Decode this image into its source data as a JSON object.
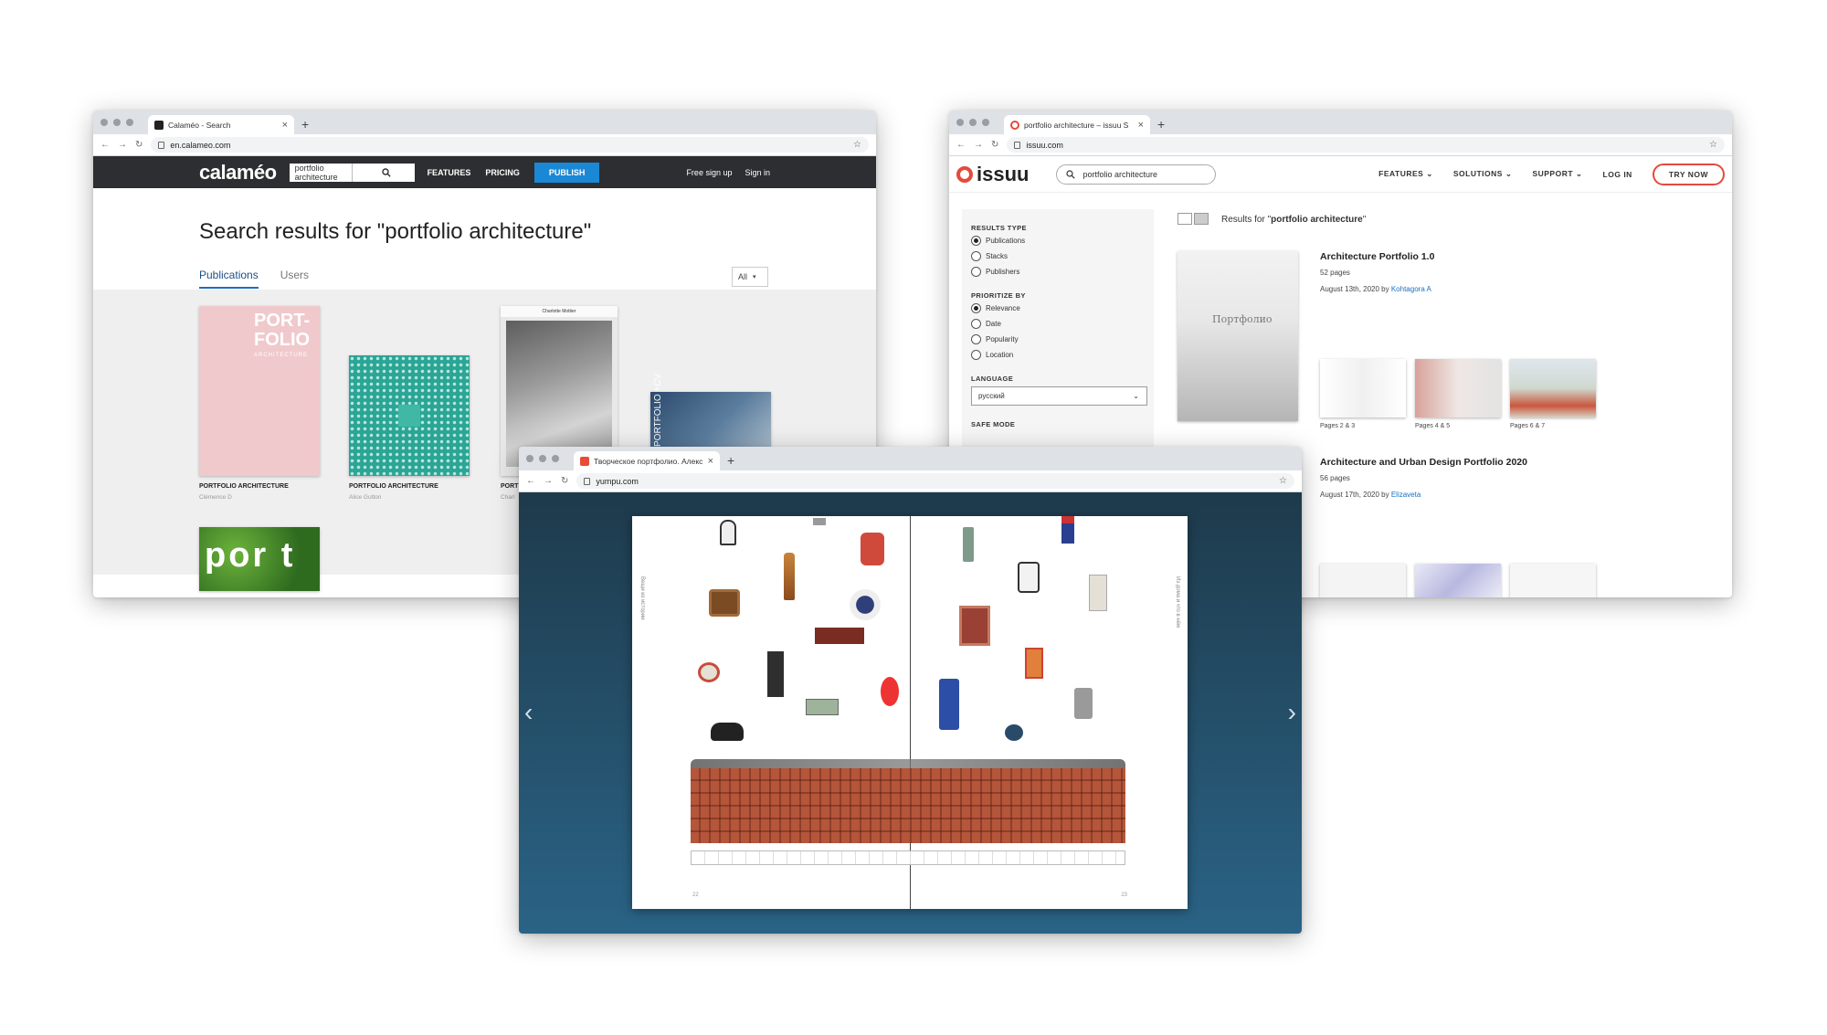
{
  "calameo": {
    "tab_title": "Calaméo - Search",
    "url": "en.calameo.com",
    "logo": "calaméo",
    "search_value": "portfolio architecture",
    "nav": {
      "features": "FEATURES",
      "pricing": "PRICING",
      "publish": "PUBLISH",
      "signup": "Free sign up",
      "signin": "Sign in"
    },
    "heading": "Search results for \"portfolio architecture\"",
    "tabs": [
      "Publications",
      "Users"
    ],
    "filter": "All",
    "cover1": {
      "line1": "PORT-",
      "line2": "FOLIO",
      "line3": "ARCHITECTURE"
    },
    "cover3_title": "Charlotte Mottier",
    "cover4_title": "PORTFOLIO +CV",
    "cover5_text": "por t",
    "results": [
      {
        "title": "PORTFOLIO ARCHITECTURE",
        "author": "Clémence D"
      },
      {
        "title": "PORTFOLIO ARCHITECTURE",
        "author": "Alice Gutton"
      },
      {
        "title": "PORT",
        "author": "Charl"
      }
    ],
    "colors": {
      "nav_bg": "#2d2e31",
      "publish": "#1b88d6",
      "accent": "#1a6fc2"
    }
  },
  "issuu": {
    "tab_title": "portfolio architecture – issuu S",
    "url": "issuu.com",
    "logo": "issuu",
    "search_value": "portfolio architecture",
    "nav": {
      "features": "FEATURES",
      "solutions": "SOLUTIONS",
      "support": "SUPPORT",
      "login": "LOG IN",
      "try": "TRY NOW"
    },
    "filters": {
      "results_type_label": "RESULTS TYPE",
      "results_type": [
        "Publications",
        "Stacks",
        "Publishers"
      ],
      "prioritize_label": "PRIORITIZE BY",
      "prioritize": [
        "Relevance",
        "Date",
        "Popularity",
        "Location"
      ],
      "language_label": "LANGUAGE",
      "language_value": "русский",
      "safe_mode_label": "SAFE MODE"
    },
    "results_prefix": "Results for ",
    "results_query": "portfolio architecture",
    "cover_text": "Портфолио",
    "items": [
      {
        "title": "Architecture Portfolio 1.0",
        "pages": "52 pages",
        "date": "August 13th, 2020 by ",
        "author": "Kohtagora A"
      },
      {
        "title": "Architecture and Urban Design Portfolio 2020",
        "pages": "56 pages",
        "date": "August 17th, 2020 by ",
        "author": "Elizaveta"
      }
    ],
    "page_labels": [
      "Pages 2 & 3",
      "Pages 4 & 5",
      "Pages 6 & 7"
    ],
    "colors": {
      "brand": "#e44a3c",
      "link": "#1a6fc2"
    }
  },
  "yumpu": {
    "tab_title": "Творческое портфолио. Алекс",
    "url": "yumpu.com",
    "left_margin_text": "Вещи из истории",
    "right_margin_text": "Из дома и что в нём",
    "page_left": "22",
    "page_right": "23",
    "colors": {
      "bg_top": "#1e3a4b",
      "bg_bottom": "#2a6386",
      "brick": "#b5553a"
    }
  }
}
